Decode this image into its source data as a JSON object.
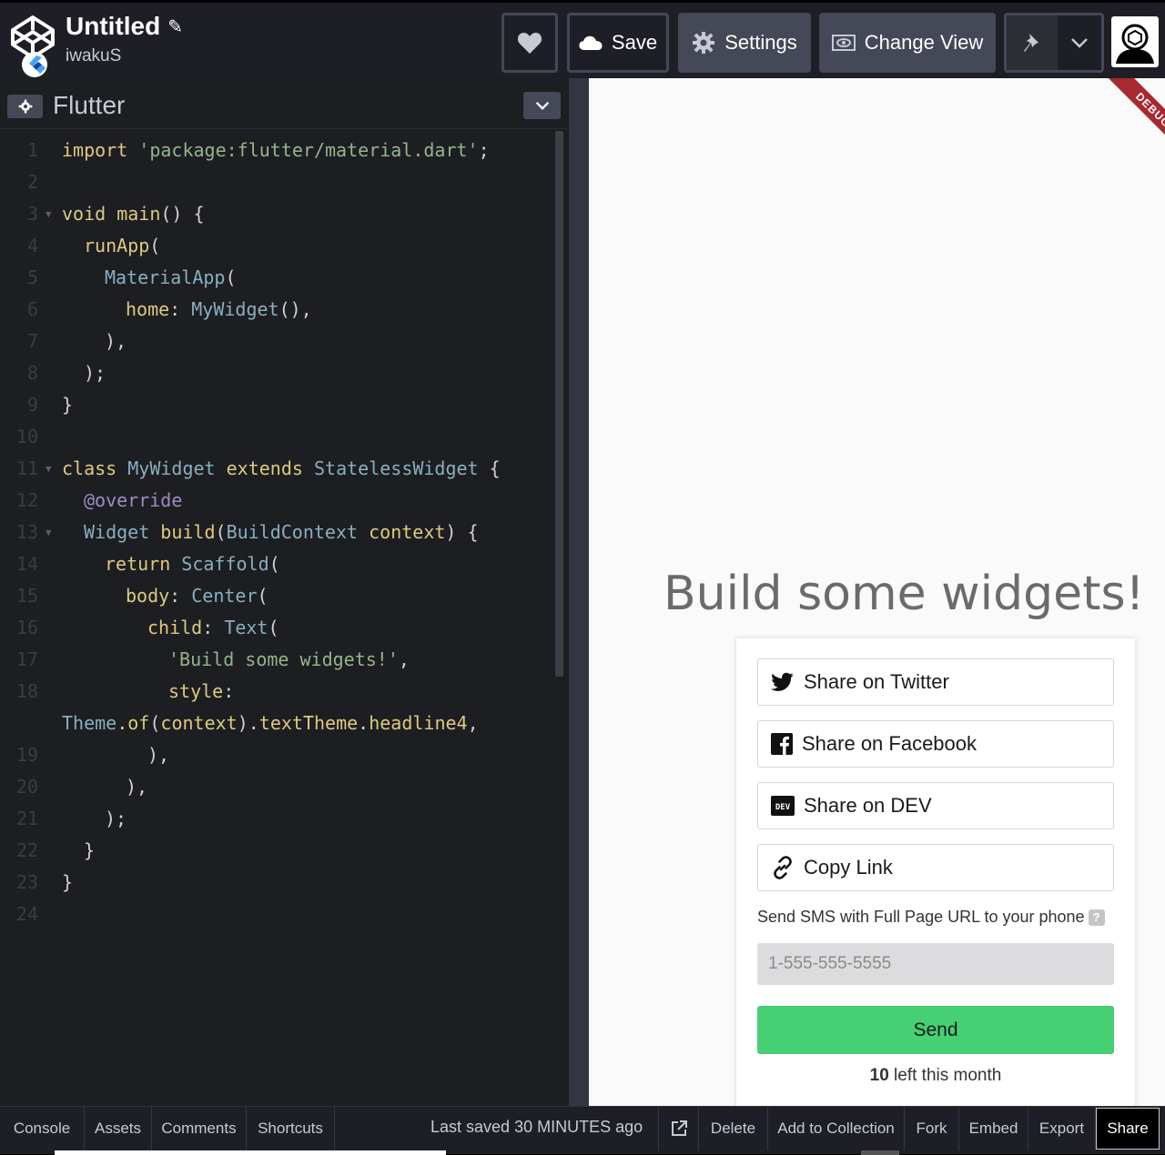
{
  "header": {
    "title": "Untitled",
    "username": "iwakuS",
    "buttons": {
      "save": "Save",
      "settings": "Settings",
      "change_view": "Change View"
    }
  },
  "editor": {
    "language": "Flutter",
    "lines": [
      {
        "n": "1"
      },
      {
        "n": "2"
      },
      {
        "n": "3"
      },
      {
        "n": "4"
      },
      {
        "n": "5"
      },
      {
        "n": "6"
      },
      {
        "n": "7"
      },
      {
        "n": "8"
      },
      {
        "n": "9"
      },
      {
        "n": "10"
      },
      {
        "n": "11"
      },
      {
        "n": "12"
      },
      {
        "n": "13"
      },
      {
        "n": "14"
      },
      {
        "n": "15"
      },
      {
        "n": "16"
      },
      {
        "n": "17"
      },
      {
        "n": "18"
      },
      {
        "n": ""
      },
      {
        "n": "19"
      },
      {
        "n": "20"
      },
      {
        "n": "21"
      },
      {
        "n": "22"
      },
      {
        "n": "23"
      },
      {
        "n": "24"
      }
    ],
    "code": {
      "l1_import": "import",
      "l1_pkg": "'package:flutter/material.dart'",
      "l1_end": ";",
      "l3_void": "void",
      "l3_main": "main",
      "l3_rest": "() {",
      "l4_runapp": "runApp",
      "l4_rest": "(",
      "l5_mat": "MaterialApp",
      "l5_rest": "(",
      "l6_home": "home",
      "l6_colon": ": ",
      "l6_widget": "MyWidget",
      "l6_rest": "(),",
      "l7": "),",
      "l8": ");",
      "l9": "}",
      "l11_class": "class",
      "l11_name": "MyWidget",
      "l11_extends": "extends",
      "l11_base": "StatelessWidget",
      "l11_rest": " {",
      "l12": "@override",
      "l13_widget": "Widget",
      "l13_build": "build",
      "l13_paren": "(",
      "l13_ctx": "BuildContext",
      "l13_context": "context",
      "l13_rest": ") {",
      "l14_return": "return",
      "l14_scaffold": "Scaffold",
      "l14_rest": "(",
      "l15_body": "body",
      "l15_colon": ": ",
      "l15_center": "Center",
      "l15_rest": "(",
      "l16_child": "child",
      "l16_colon": ": ",
      "l16_text": "Text",
      "l16_rest": "(",
      "l17_str": "'Build some widgets!'",
      "l17_rest": ",",
      "l18_style": "style",
      "l18_colon": ":",
      "l18b_theme": "Theme",
      "l18b_dot": ".",
      "l18b_of": "of",
      "l18b_paren": "(",
      "l18b_context": "context",
      "l18b_close": ").",
      "l18b_tt": "textTheme",
      "l18b_dot2": ".",
      "l18b_h4": "headline4",
      "l18b_comma": ",",
      "l19": "),",
      "l20": "),",
      "l21": ");",
      "l22": "}",
      "l23": "}"
    }
  },
  "preview": {
    "debug_label": "DEBUG",
    "headline": "Build some widgets!"
  },
  "share_panel": {
    "twitter": "Share on Twitter",
    "facebook": "Share on Facebook",
    "dev": "Share on DEV",
    "copy": "Copy Link",
    "sms_label": "Send SMS with Full Page URL to your phone",
    "phone_placeholder": "1-555-555-5555",
    "send": "Send",
    "left_count": "10",
    "left_text": " left this month"
  },
  "footer": {
    "console": "Console",
    "assets": "Assets",
    "comments": "Comments",
    "shortcuts": "Shortcuts",
    "saved_prefix": "Last saved ",
    "saved_time": "30 MINUTES",
    "saved_suffix": " ago",
    "delete": "Delete",
    "add_collection": "Add to Collection",
    "fork": "Fork",
    "embed": "Embed",
    "export": "Export",
    "share": "Share"
  },
  "colors": {
    "header_bg": "#1e1f26",
    "button_bg": "#444857",
    "send_green": "#47cf73",
    "debug_red": "#a62a2f"
  }
}
